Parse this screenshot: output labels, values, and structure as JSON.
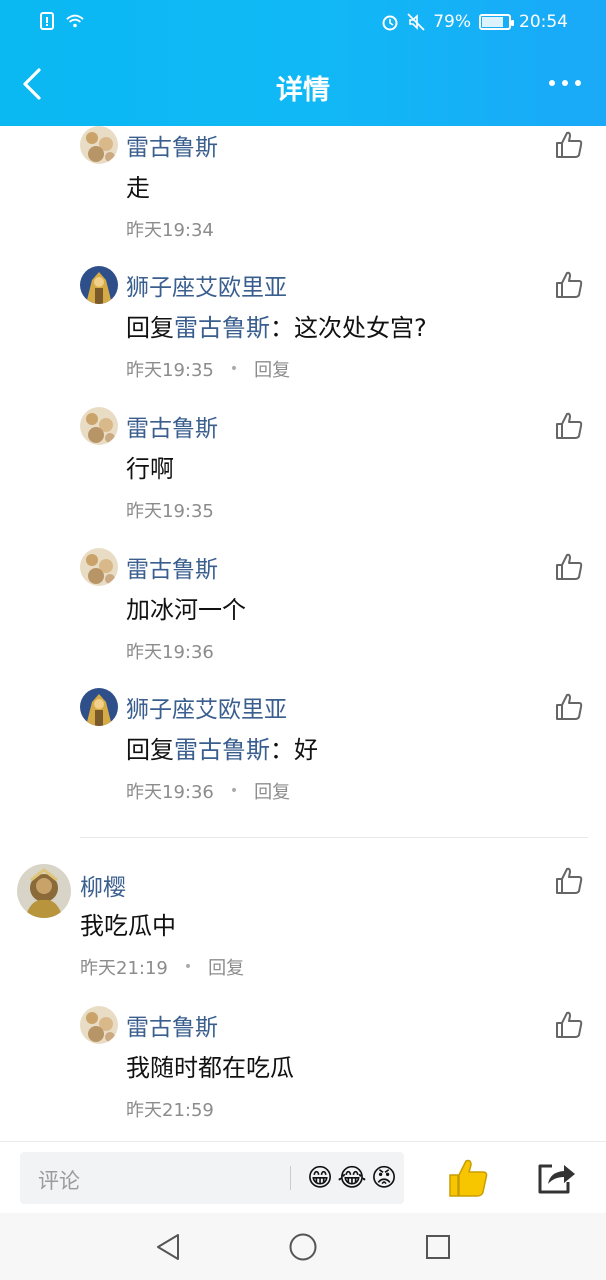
{
  "status_bar": {
    "battery": "79%",
    "time": "20:54",
    "battery_level": 0.79
  },
  "nav": {
    "title": "详情"
  },
  "replies": [
    {
      "user": "雷古鲁斯",
      "avatar": "regulus",
      "content": "走",
      "time": "昨天19:34",
      "reply_label": ""
    },
    {
      "user": "狮子座艾欧里亚",
      "avatar": "aiolia",
      "reply_prefix": "回复",
      "reply_to": "雷古鲁斯",
      "content": "：这次处女宫?",
      "time": "昨天19:35",
      "reply_label": "回复"
    },
    {
      "user": "雷古鲁斯",
      "avatar": "regulus",
      "content": "行啊",
      "time": "昨天19:35",
      "reply_label": ""
    },
    {
      "user": "雷古鲁斯",
      "avatar": "regulus",
      "content": "加冰河一个",
      "time": "昨天19:36",
      "reply_label": ""
    },
    {
      "user": "狮子座艾欧里亚",
      "avatar": "aiolia",
      "reply_prefix": "回复",
      "reply_to": "雷古鲁斯",
      "content": "：好",
      "time": "昨天19:36",
      "reply_label": "回复"
    }
  ],
  "top_comment": {
    "user": "柳樱",
    "content": "我吃瓜中",
    "time": "昨天21:19",
    "reply_label": "回复"
  },
  "last_reply": {
    "user": "雷古鲁斯",
    "content": "我随时都在吃瓜",
    "time": "昨天21:59"
  },
  "composer": {
    "placeholder": "评论",
    "emojis": [
      "😁",
      "😂",
      "😡"
    ]
  },
  "colors": {
    "header": "#10b9f5",
    "name": "#3a5f8f",
    "like_active": "#f7c600"
  }
}
